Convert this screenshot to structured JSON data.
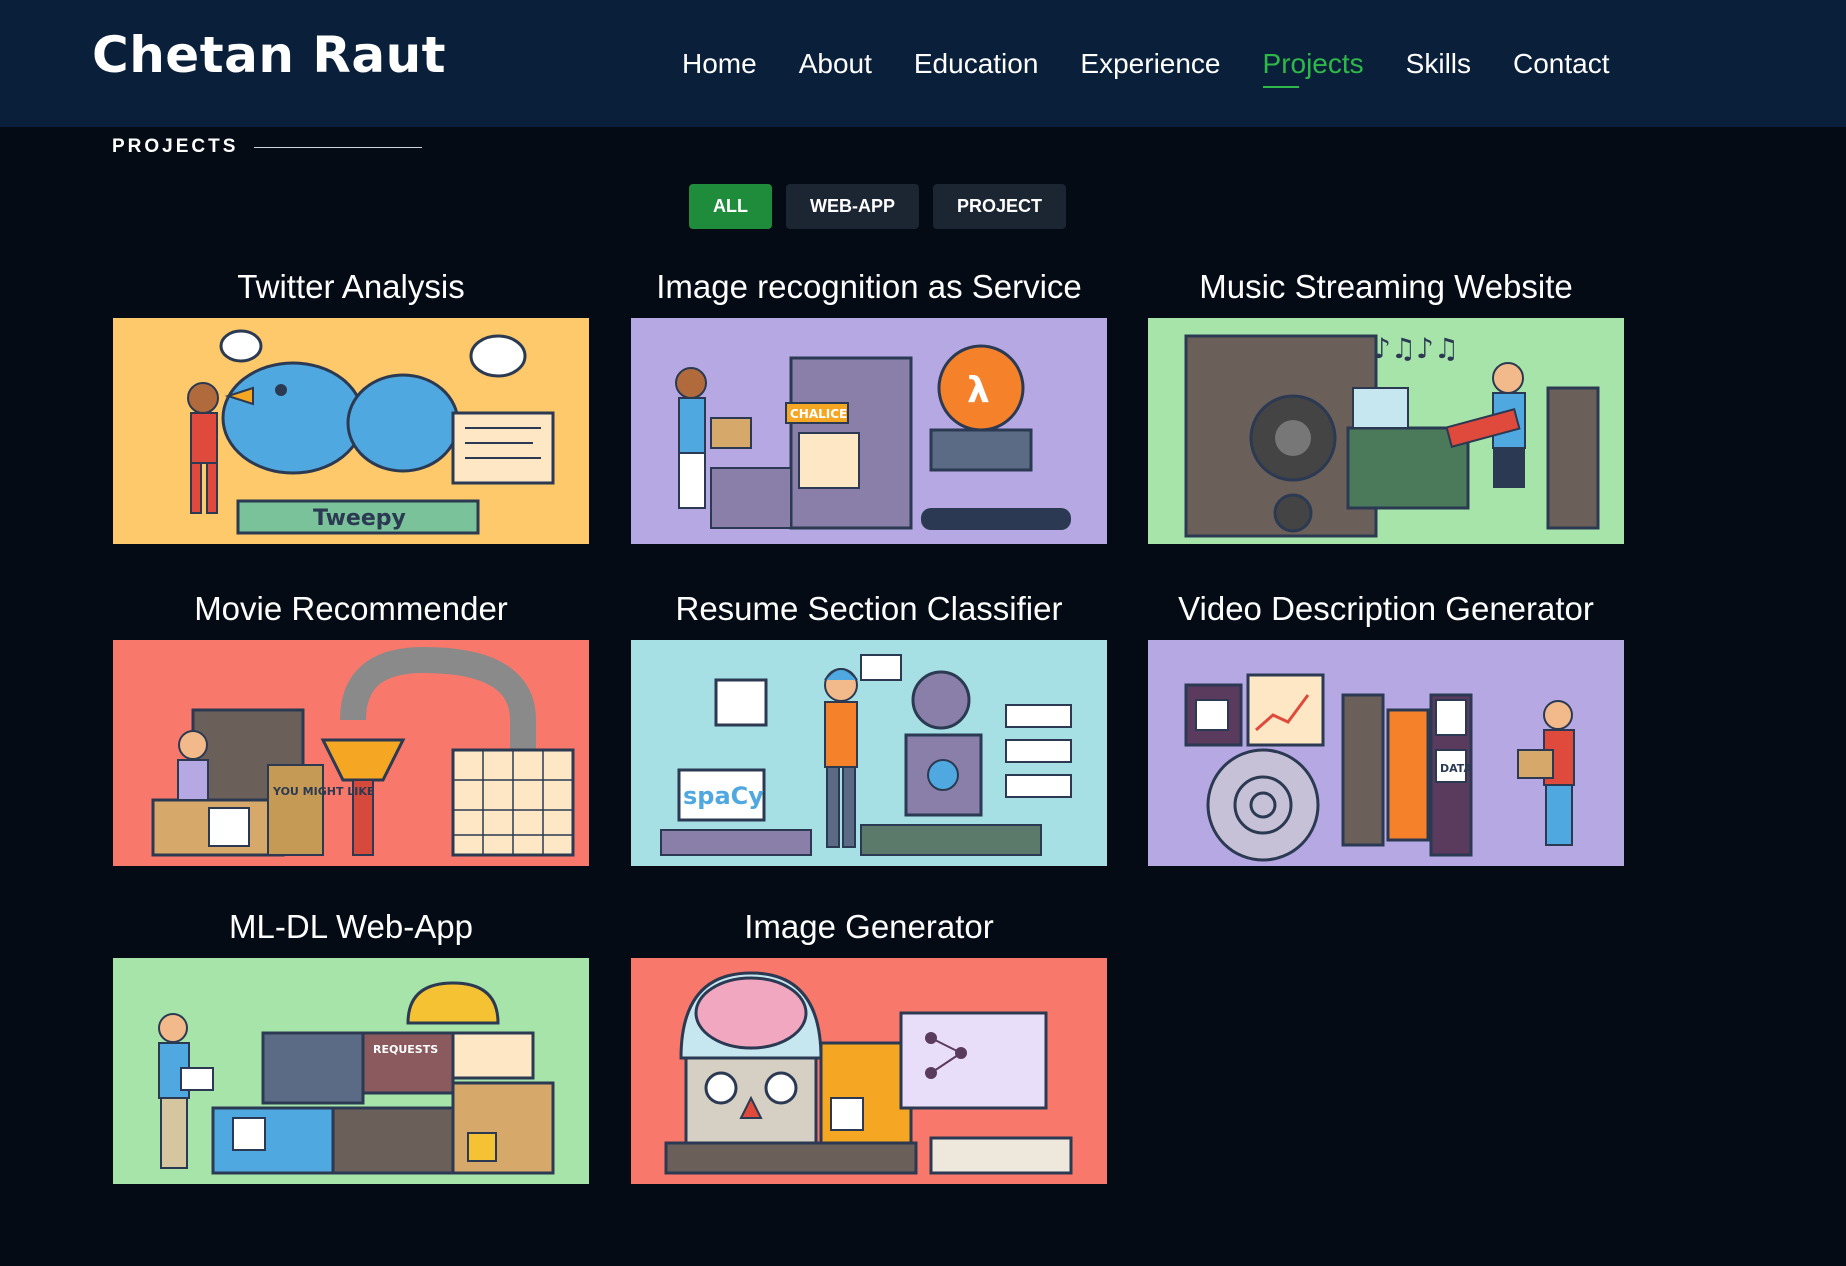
{
  "header": {
    "logo": "Chetan Raut",
    "nav": [
      {
        "label": "Home"
      },
      {
        "label": "About"
      },
      {
        "label": "Education"
      },
      {
        "label": "Experience"
      },
      {
        "label": "Projects",
        "active": true
      },
      {
        "label": "Skills"
      },
      {
        "label": "Contact"
      }
    ]
  },
  "section": {
    "title": "PROJECTS"
  },
  "filters": [
    {
      "label": "ALL",
      "active": true
    },
    {
      "label": "WEB-APP"
    },
    {
      "label": "PROJECT"
    }
  ],
  "projects": [
    {
      "title": "Twitter Analysis",
      "bg": "#fdc96a",
      "illustration": "twitter-tweepy-illustration",
      "label": "Tweepy"
    },
    {
      "title": "Image recognition as Service",
      "bg": "#b6a8e3",
      "illustration": "aws-lambda-illustration",
      "label": "CHALICE"
    },
    {
      "title": "Music Streaming Website",
      "bg": "#a7e4a9",
      "illustration": "music-studio-illustration",
      "label": ""
    },
    {
      "title": "Movie Recommender",
      "bg": "#f9786c",
      "illustration": "movie-recommender-illustration",
      "label": "YOU MIGHT LIKE"
    },
    {
      "title": "Resume Section Classifier",
      "bg": "#a6dfe4",
      "illustration": "nlp-robot-illustration",
      "label": "spaCy"
    },
    {
      "title": "Video Description Generator",
      "bg": "#b6a8e3",
      "illustration": "video-data-illustration",
      "label": "DATA"
    },
    {
      "title": "ML-DL Web-App",
      "bg": "#a7e4a9",
      "illustration": "web-api-illustration",
      "label": "REQUESTS"
    },
    {
      "title": "Image Generator",
      "bg": "#f9786c",
      "illustration": "brain-generator-illustration",
      "label": ""
    }
  ]
}
